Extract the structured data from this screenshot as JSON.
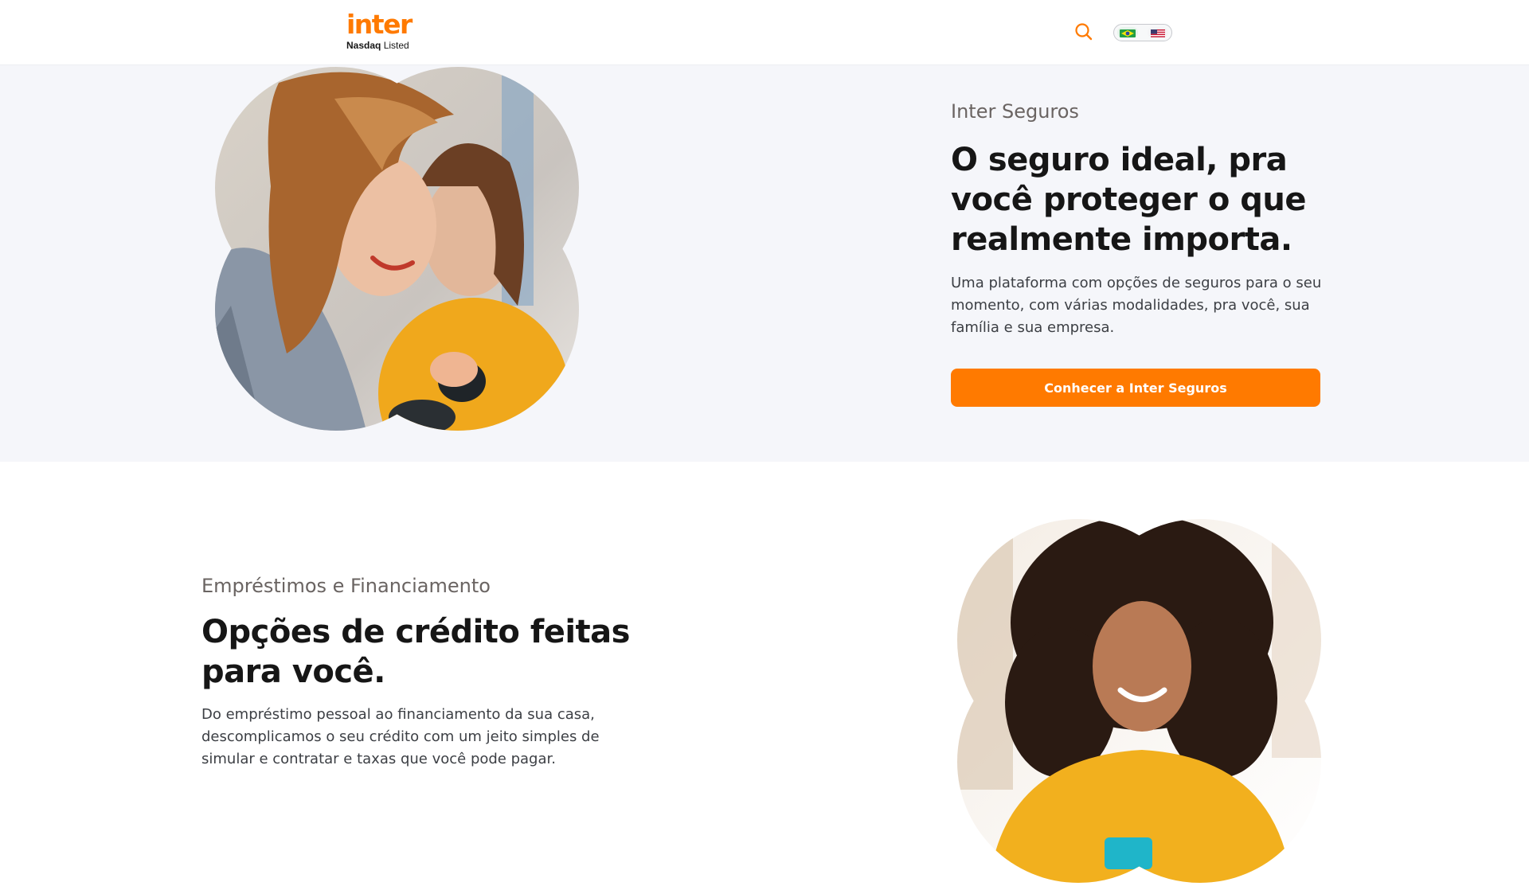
{
  "header": {
    "logo_word": "inter",
    "logo_sub_bold": "Nasdaq",
    "logo_sub_rest": " Listed",
    "search_icon": "search-icon",
    "languages": [
      "pt-BR",
      "en-US"
    ],
    "accent": "#ff7a00"
  },
  "insurance": {
    "eyebrow": "Inter Seguros",
    "title": "O seguro ideal, pra você proteger o que realmente importa.",
    "body": "Uma plataforma com opções de seguros para o seu momento, com várias modalidades, pra você, sua família e sua empresa.",
    "cta": "Conhecer a Inter Seguros",
    "image": "two-women-laughing-photo"
  },
  "credit": {
    "eyebrow": "Empréstimos e Financiamento",
    "title": "Opções de crédito feitas para você.",
    "body": "Do empréstimo pessoal ao financiamento da sua casa, descomplicamos o seu crédito com um jeito simples de simular e contratar e taxas que você pode pagar.",
    "image": "woman-curly-hair-phone-photo"
  },
  "colors": {
    "brand_orange": "#ff7a00",
    "section_bg": "#f5f6fa",
    "heading": "#161616",
    "eyebrow": "#6a6462",
    "body": "#3c3f44"
  }
}
